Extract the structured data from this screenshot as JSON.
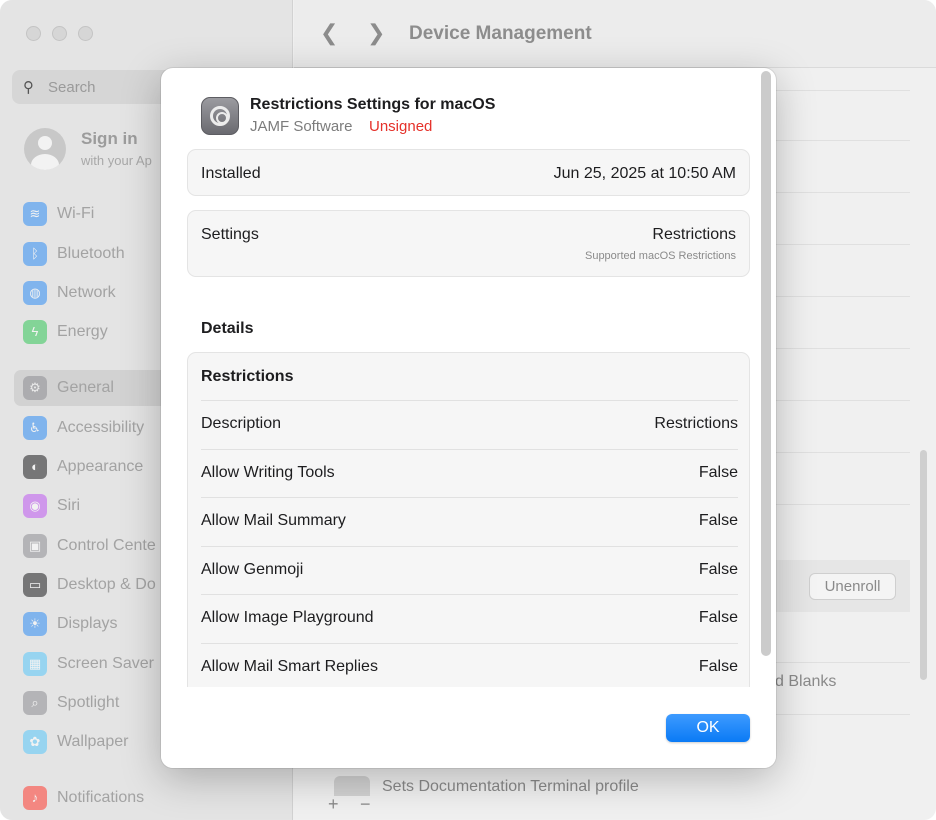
{
  "background_window": {
    "title": "Device Management",
    "search_placeholder": "Search",
    "signin": {
      "title": "Sign in",
      "subtitle": "with your Ap"
    },
    "sidebar_items": [
      {
        "label": "Wi-Fi",
        "icon": "wifi-icon",
        "color": "#2f8df5"
      },
      {
        "label": "Bluetooth",
        "icon": "bluetooth-icon",
        "color": "#2f8df5"
      },
      {
        "label": "Network",
        "icon": "globe-icon",
        "color": "#2f8df5"
      },
      {
        "label": "Energy",
        "icon": "bolt-icon",
        "color": "#34c759"
      },
      {
        "label": "General",
        "icon": "gear-icon",
        "color": "#8e8e93",
        "selected": true
      },
      {
        "label": "Accessibility",
        "icon": "accessibility-icon",
        "color": "#2f8df5"
      },
      {
        "label": "Appearance",
        "icon": "appearance-icon",
        "color": "#1d1d1f"
      },
      {
        "label": "Siri",
        "icon": "siri-icon",
        "color": "#bf5af2"
      },
      {
        "label": "Control Cente",
        "icon": "control-center-icon",
        "color": "#8e8e93"
      },
      {
        "label": "Desktop & Do",
        "icon": "desktop-icon",
        "color": "#1d1d1f"
      },
      {
        "label": "Displays",
        "icon": "displays-icon",
        "color": "#2f8df5"
      },
      {
        "label": "Screen Saver",
        "icon": "screen-saver-icon",
        "color": "#5ac8fa"
      },
      {
        "label": "Spotlight",
        "icon": "spotlight-icon",
        "color": "#8e8e93"
      },
      {
        "label": "Wallpaper",
        "icon": "wallpaper-icon",
        "color": "#5ac8fa"
      },
      {
        "label": "Notifications",
        "icon": "bell-icon",
        "color": "#ff3b30"
      }
    ],
    "unenroll_label": "Unenroll",
    "blanks_text": "d Blanks",
    "sets_text": "Sets Documentation Terminal profile",
    "add_label": "+",
    "remove_label": "−"
  },
  "profile": {
    "title": "Restrictions Settings for macOS",
    "vendor": "JAMF Software",
    "status": "Unsigned",
    "status_color": "#e5312a",
    "installed_label": "Installed",
    "installed_value": "Jun 25, 2025 at 10:50 AM",
    "settings_label": "Settings",
    "settings_value": "Restrictions",
    "settings_sub": "Supported macOS Restrictions"
  },
  "details": {
    "heading": "Details",
    "section_title": "Restrictions",
    "rows": [
      {
        "key": "Description",
        "value": "Restrictions"
      },
      {
        "key": "Allow Writing Tools",
        "value": "False"
      },
      {
        "key": "Allow Mail Summary",
        "value": "False"
      },
      {
        "key": "Allow Genmoji",
        "value": "False"
      },
      {
        "key": "Allow Image Playground",
        "value": "False"
      },
      {
        "key": "Allow Mail Smart Replies",
        "value": "False"
      }
    ]
  },
  "footer": {
    "ok_label": "OK",
    "accent": "#0a7af5"
  }
}
